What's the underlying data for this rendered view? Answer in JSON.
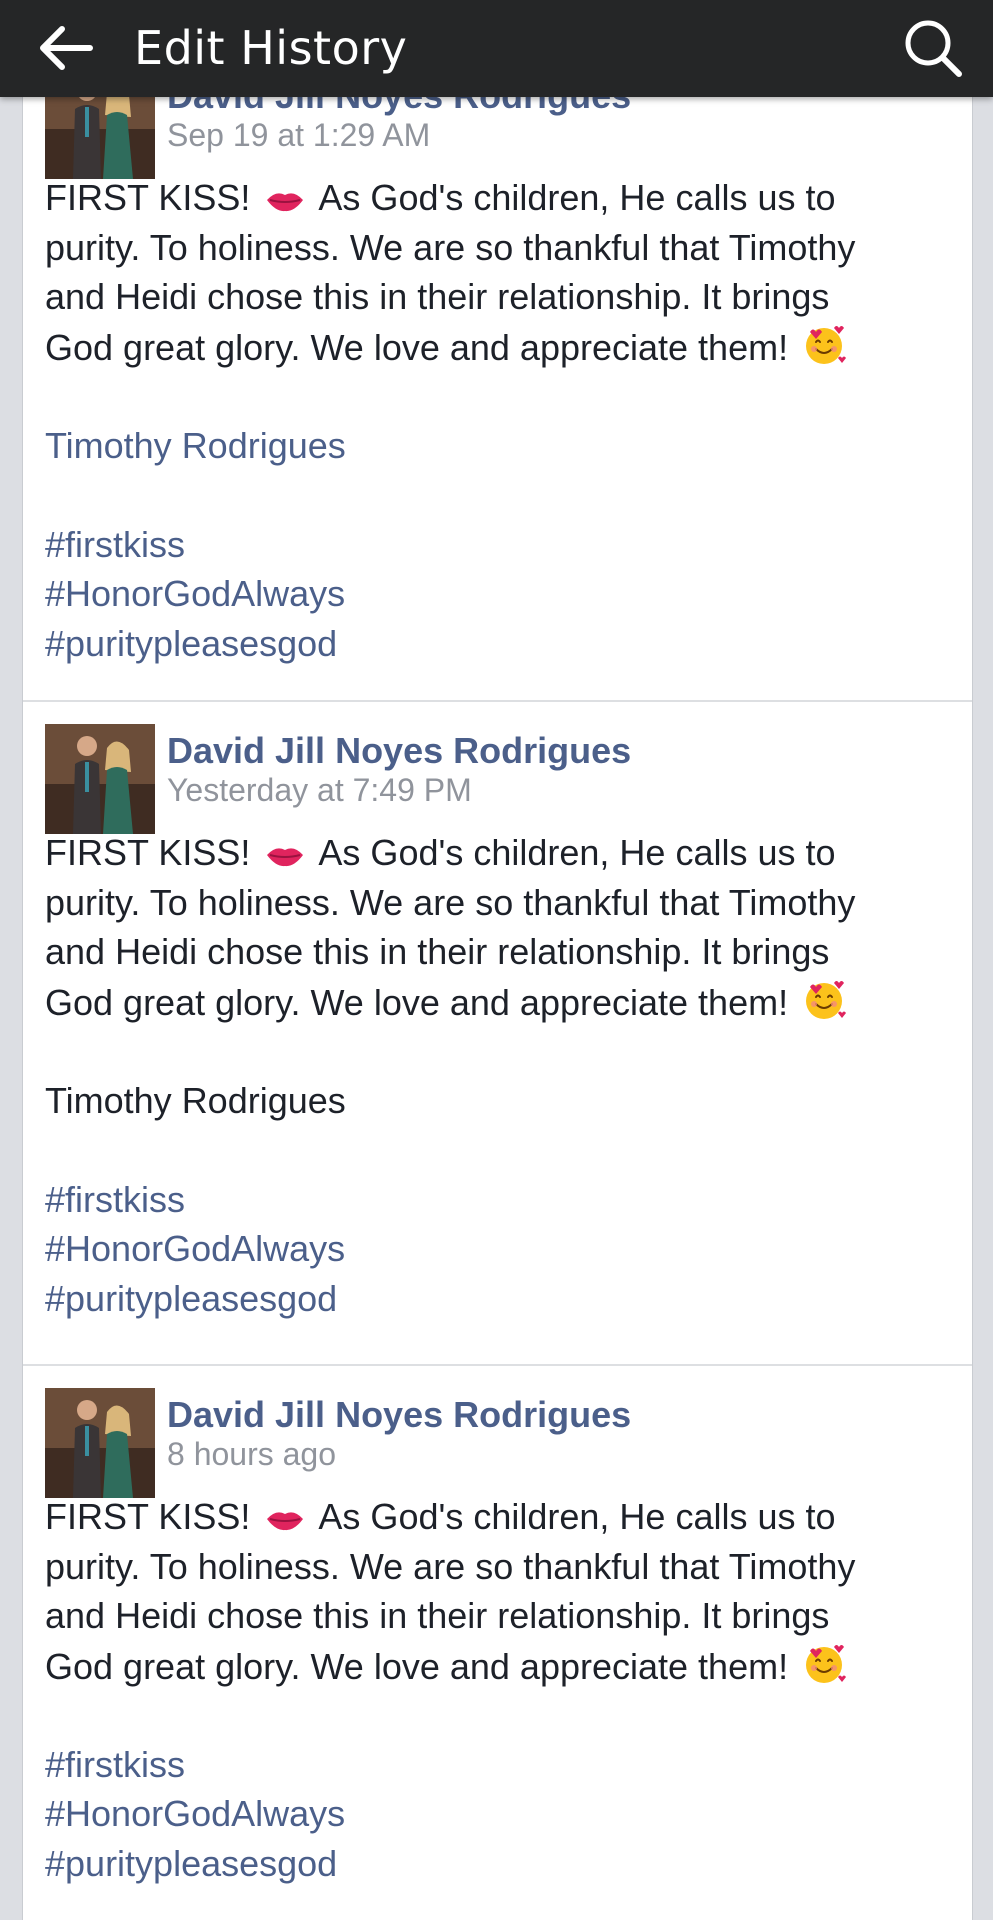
{
  "header": {
    "title": "Edit History",
    "back_icon": "arrow-left-icon",
    "search_icon": "search-icon"
  },
  "edits": [
    {
      "author": "David Jill Noyes Rodrigues",
      "timestamp": "Sep 19 at 1:29 AM",
      "text_lines": [
        "FIRST KISS!",
        "As God's children, He calls us to",
        "purity. To holiness. We are so thankful that Timothy",
        "and Heidi chose this in their relationship. It brings",
        "God great glory. We love and appreciate them!"
      ],
      "tagged_name": "Timothy Rodrigues",
      "tagged_name_is_link": true,
      "hashtags": [
        "#firstkiss",
        "#HonorGodAlways",
        "#puritypleasesgod"
      ]
    },
    {
      "author": "David Jill Noyes Rodrigues",
      "timestamp": "Yesterday at 7:49 PM",
      "text_lines": [
        "FIRST KISS!",
        "As God's children, He calls us to",
        "purity. To holiness. We are so thankful that Timothy",
        "and Heidi chose this in their relationship. It brings",
        "God great glory. We love and appreciate them!"
      ],
      "tagged_name": "Timothy Rodrigues",
      "tagged_name_is_link": false,
      "hashtags": [
        "#firstkiss",
        "#HonorGodAlways",
        "#puritypleasesgod"
      ]
    },
    {
      "author": "David Jill Noyes Rodrigues",
      "timestamp": "8 hours ago",
      "text_lines": [
        "FIRST KISS!",
        "As God's children, He calls us to",
        "purity. To holiness. We are so thankful that Timothy",
        "and Heidi chose this in their relationship. It brings",
        "God great glory. We love and appreciate them!"
      ],
      "hashtags": [
        "#firstkiss",
        "#HonorGodAlways",
        "#puritypleasesgod"
      ]
    }
  ],
  "emoji": {
    "lips": "lips-emoji",
    "smile": "smiling-face-with-hearts-emoji"
  },
  "colors": {
    "topbar": "#252627",
    "link": "#4b5f8a",
    "timestamp": "#90949c",
    "text": "#1d2129",
    "background": "#dcdee3"
  }
}
